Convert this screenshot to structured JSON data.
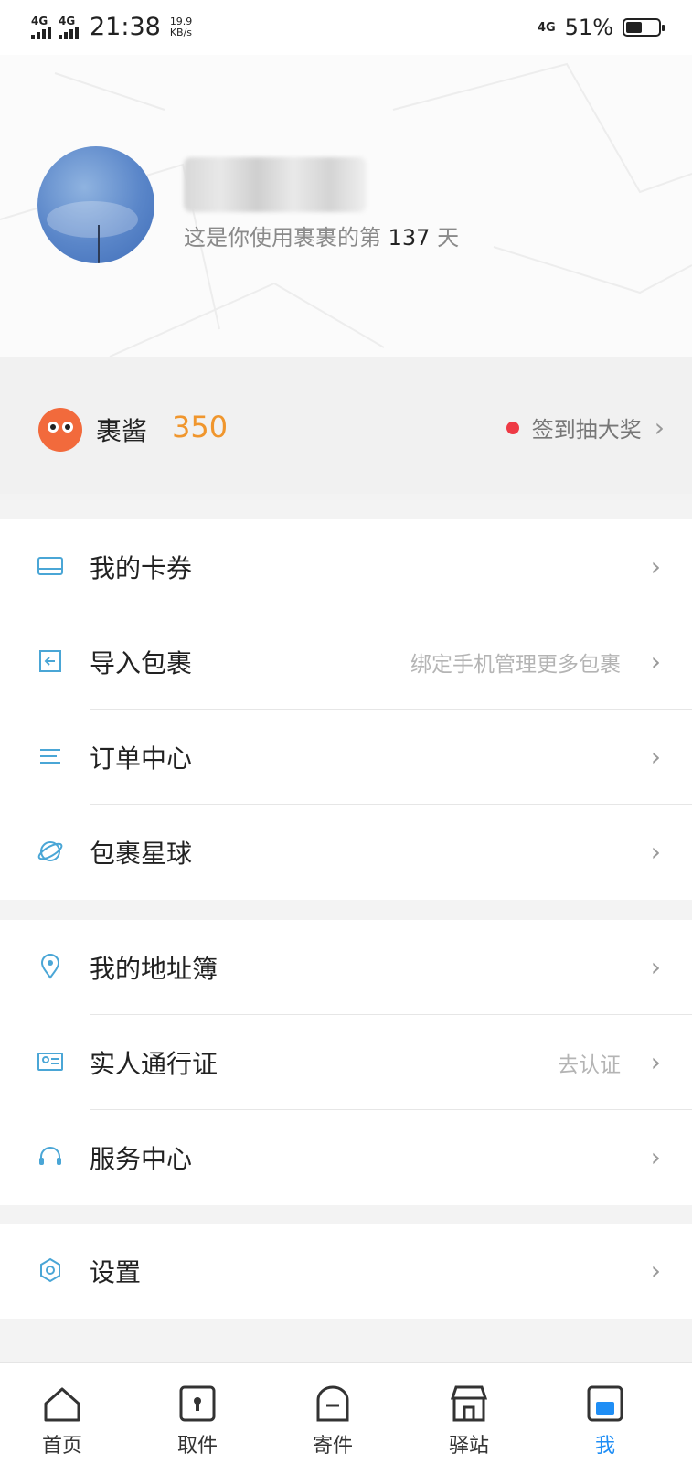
{
  "status_bar": {
    "network1": "4G",
    "network2": "4G",
    "time": "21:38",
    "speed_value": "19.9",
    "speed_unit": "KB/s",
    "network_right": "4G",
    "battery_percent": "51%",
    "battery_level": 0.51
  },
  "profile": {
    "days_prefix": "这是你使用裹裹的第",
    "days_count": "137",
    "days_suffix": "天"
  },
  "coins": {
    "name": "裹酱",
    "value": "350",
    "signin_label": "签到抽大奖"
  },
  "menu_group1": [
    {
      "label": "我的卡券",
      "hint": "",
      "icon": "card-icon"
    },
    {
      "label": "导入包裹",
      "hint": "绑定手机管理更多包裹",
      "icon": "import-icon"
    },
    {
      "label": "订单中心",
      "hint": "",
      "icon": "list-icon"
    },
    {
      "label": "包裹星球",
      "hint": "",
      "icon": "planet-icon"
    }
  ],
  "menu_group2": [
    {
      "label": "我的地址簿",
      "hint": "",
      "icon": "location-icon"
    },
    {
      "label": "实人通行证",
      "hint": "去认证",
      "icon": "id-card-icon"
    },
    {
      "label": "服务中心",
      "hint": "",
      "icon": "headset-icon"
    }
  ],
  "menu_group3": [
    {
      "label": "设置",
      "hint": "",
      "icon": "settings-icon"
    }
  ],
  "tabs": [
    {
      "label": "首页",
      "icon": "home-icon"
    },
    {
      "label": "取件",
      "icon": "pickup-icon"
    },
    {
      "label": "寄件",
      "icon": "send-icon"
    },
    {
      "label": "驿站",
      "icon": "station-icon"
    },
    {
      "label": "我",
      "icon": "me-icon"
    }
  ],
  "colors": {
    "accent": "#1f8ef5",
    "coin": "#f0962d",
    "icon_blue": "#4aa6d6",
    "red_dot": "#ee3a45"
  }
}
